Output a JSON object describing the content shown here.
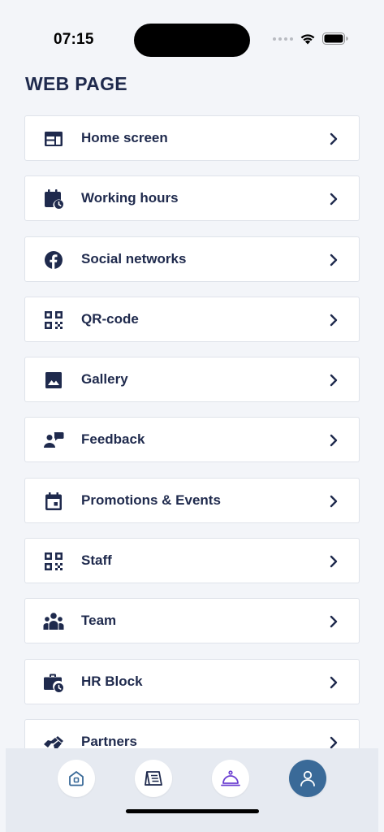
{
  "status_bar": {
    "time": "07:15"
  },
  "page": {
    "title": "WEB PAGE"
  },
  "menu": {
    "items": [
      {
        "label": "Home screen",
        "icon": "home-screen-icon"
      },
      {
        "label": "Working hours",
        "icon": "calendar-clock-icon"
      },
      {
        "label": "Social networks",
        "icon": "facebook-icon"
      },
      {
        "label": "QR-code",
        "icon": "qr-code-icon"
      },
      {
        "label": "Gallery",
        "icon": "image-icon"
      },
      {
        "label": "Feedback",
        "icon": "feedback-icon"
      },
      {
        "label": "Promotions & Events",
        "icon": "event-calendar-icon"
      },
      {
        "label": "Staff",
        "icon": "qr-code-icon"
      },
      {
        "label": "Team",
        "icon": "team-icon"
      },
      {
        "label": "HR Block",
        "icon": "briefcase-clock-icon"
      },
      {
        "label": "Partners",
        "icon": "handshake-icon"
      }
    ]
  },
  "bottom_nav": {
    "items": [
      {
        "icon": "home-icon",
        "active": false
      },
      {
        "icon": "menu-book-icon",
        "active": false
      },
      {
        "icon": "service-bell-icon",
        "active": false
      },
      {
        "icon": "profile-icon",
        "active": true
      }
    ]
  },
  "colors": {
    "text_primary": "#1f2a4d",
    "background": "#f3f5f9",
    "card": "#ffffff",
    "active_nav": "#3a6a98",
    "bell_accent": "#6b3fd1"
  }
}
